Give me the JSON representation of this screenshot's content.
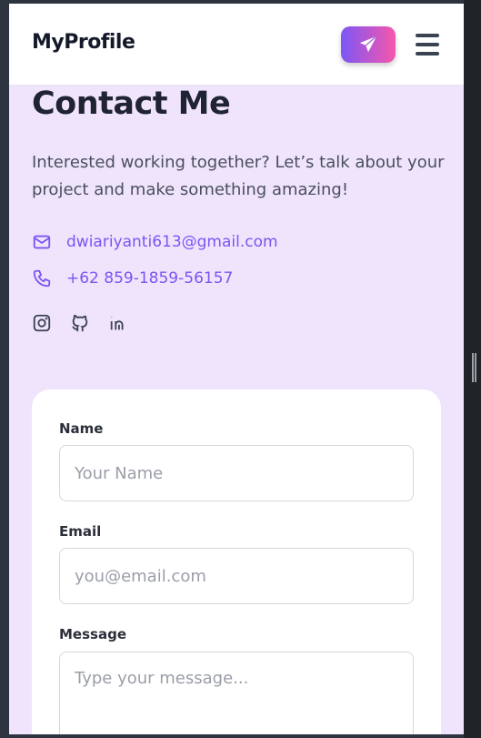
{
  "header": {
    "logo": "MyProfile",
    "send_icon": "paper-plane-icon",
    "menu_icon": "hamburger-icon"
  },
  "contact": {
    "title": "Contact Me",
    "intro": "Interested working together? Let’s talk about your project and make something amazing!",
    "email": "dwiariyanti613@gmail.com",
    "phone": "+62 859-1859-56157",
    "socials": [
      "instagram-icon",
      "github-icon",
      "linkedin-icon"
    ]
  },
  "form": {
    "name_label": "Name",
    "name_placeholder": "Your Name",
    "email_label": "Email",
    "email_placeholder": "you@email.com",
    "message_label": "Message",
    "message_placeholder": "Type your message..."
  },
  "colors": {
    "accent": "#7a55f0",
    "bg": "#f0e4fd",
    "gradient_start": "#7c57f5",
    "gradient_end": "#f657ac"
  }
}
